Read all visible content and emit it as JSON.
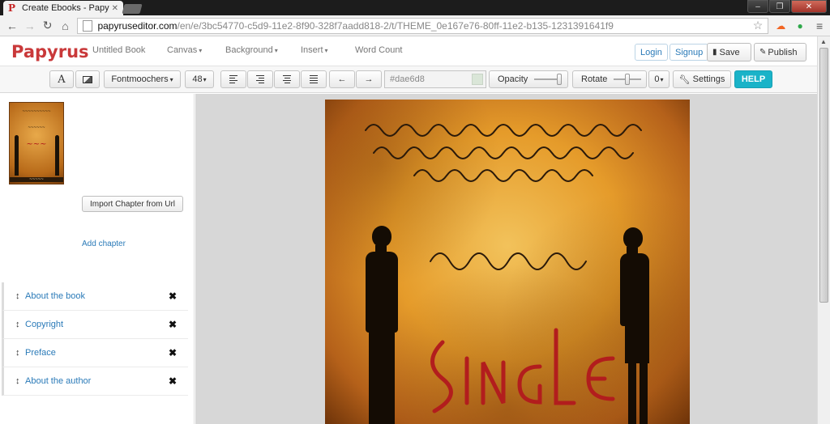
{
  "browser": {
    "tab_title": "Create Ebooks - Papyrus E",
    "tab_close": "✕",
    "favicon": "P",
    "url_host": "papyruseditor.com",
    "url_path": "/en/e/3bc54770-c5d9-11e2-8f90-328f7aadd818-2/t/THEME_0e167e76-80ff-11e2-b135-1231391641f9",
    "win_minimize": "–",
    "win_maximize": "❐",
    "win_close": "✕",
    "back_glyph": "←",
    "forward_glyph": "→",
    "reload_glyph": "↻",
    "home_glyph": "⌂",
    "star_glyph": "☆",
    "menu_glyph": "≡"
  },
  "app": {
    "logo": "Papyrus",
    "menu": {
      "book": "Untitled Book",
      "canvas": "Canvas",
      "background": "Background",
      "insert": "Insert",
      "word_count": "Word Count",
      "caret": "▾"
    },
    "buttons": {
      "login": "Login",
      "signup": "Signup",
      "save": "Save",
      "publish": "Publish"
    }
  },
  "toolbar": {
    "text_tool": "A",
    "font": "Fontmoochers",
    "font_caret": "▾",
    "size": "48",
    "color_value": "#dae6d8",
    "opacity_label": "Opacity",
    "rotate_label": "Rotate",
    "rotate_value": "0",
    "settings": "Settings",
    "help": "HELP",
    "arrow_left": "←",
    "arrow_right": "→",
    "opacity_level": 1.0,
    "rotate_level": 0.5
  },
  "sidebar": {
    "import_button": "Import Chapter from Url",
    "add_chapter": "Add chapter",
    "drag_glyph": "↕",
    "remove_glyph": "✖",
    "chapters": [
      {
        "label": "About the book"
      },
      {
        "label": "Copyright"
      },
      {
        "label": "Preface"
      },
      {
        "label": "About the author"
      }
    ]
  },
  "colors": {
    "brand": "#c9393a",
    "link": "#2a7ab8",
    "help": "#1ab3c8",
    "swatch": "#dae6d8",
    "single_text": "#b21d1d"
  }
}
